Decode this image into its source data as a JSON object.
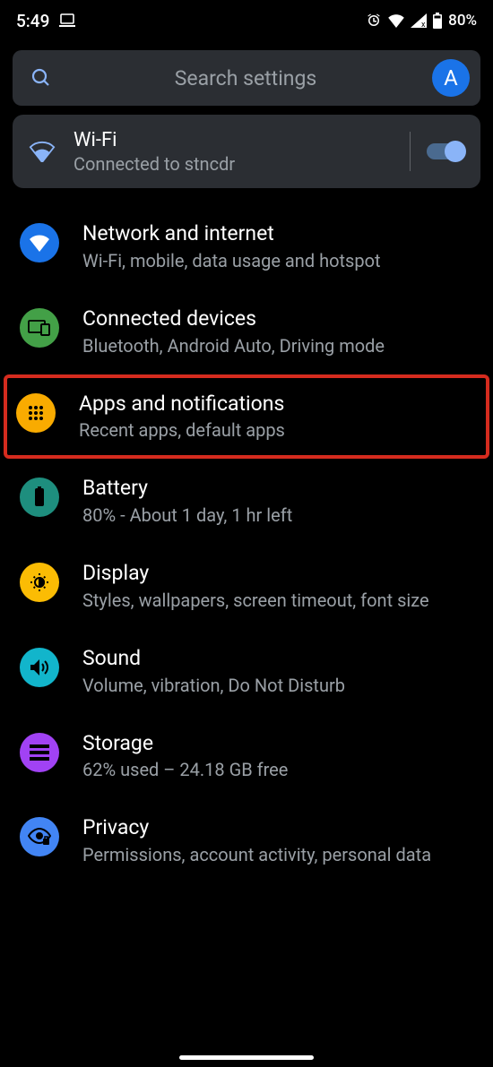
{
  "status": {
    "time": "5:49",
    "battery_pct": "80%"
  },
  "search": {
    "placeholder": "Search settings",
    "avatar_letter": "A"
  },
  "wifi_card": {
    "title": "Wi-Fi",
    "subtitle": "Connected to stncdr",
    "enabled": true
  },
  "items": [
    {
      "title": "Network and internet",
      "subtitle": "Wi-Fi, mobile, data usage and hotspot",
      "icon": "wifi-icon",
      "color": "ic-blue",
      "highlighted": false
    },
    {
      "title": "Connected devices",
      "subtitle": "Bluetooth, Android Auto, Driving mode",
      "icon": "devices-icon",
      "color": "ic-green",
      "highlighted": false
    },
    {
      "title": "Apps and notifications",
      "subtitle": "Recent apps, default apps",
      "icon": "apps-icon",
      "color": "ic-orange",
      "highlighted": true
    },
    {
      "title": "Battery",
      "subtitle": "80% - About 1 day, 1 hr left",
      "icon": "battery-icon",
      "color": "ic-teal",
      "highlighted": false
    },
    {
      "title": "Display",
      "subtitle": "Styles, wallpapers, screen timeout, font size",
      "icon": "display-icon",
      "color": "ic-amber",
      "highlighted": false
    },
    {
      "title": "Sound",
      "subtitle": "Volume, vibration, Do Not Disturb",
      "icon": "sound-icon",
      "color": "ic-cyan",
      "highlighted": false
    },
    {
      "title": "Storage",
      "subtitle": "62% used – 24.18 GB free",
      "icon": "storage-icon",
      "color": "ic-purple",
      "highlighted": false
    },
    {
      "title": "Privacy",
      "subtitle": "Permissions, account activity, personal data",
      "icon": "privacy-icon",
      "color": "ic-blue2",
      "highlighted": false
    }
  ]
}
